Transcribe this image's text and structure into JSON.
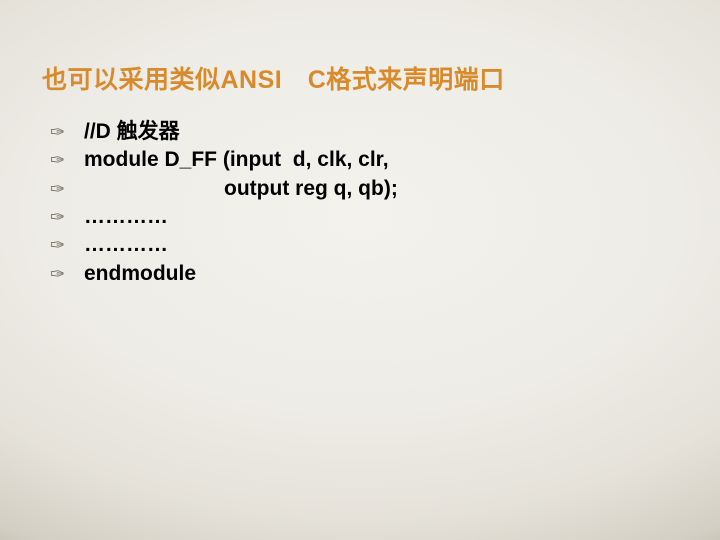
{
  "title": "也可以采用类似ANSI　C格式来声明端口",
  "bullet_glyph": "✑",
  "lines": [
    "//D 触发器",
    "module D_FF (input  d, clk, clr,",
    "                        output reg q, qb);",
    "…………",
    "…………",
    "endmodule"
  ]
}
